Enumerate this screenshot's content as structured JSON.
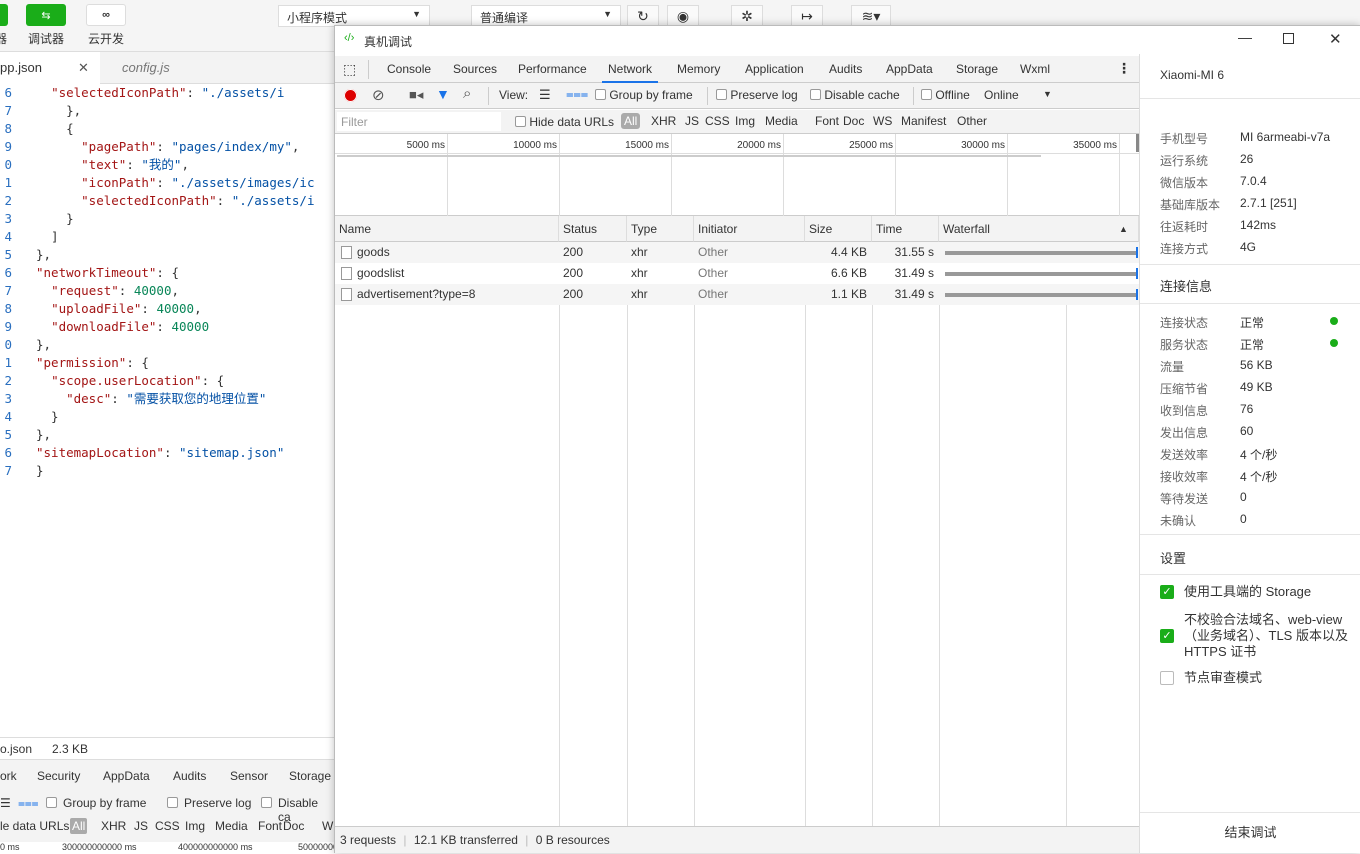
{
  "toolbar": {
    "debugger_label": "调试器",
    "cloud_label": "云开发",
    "mode_select": "小程序模式",
    "compile_select": "普通编译",
    "left_cut_label": "器"
  },
  "editor": {
    "tabs": [
      {
        "label": "pp.json"
      },
      {
        "label": "config.js"
      }
    ],
    "lines": [
      {
        "n": "6",
        "html": "  \"selectedIconPath\": \"./assets/i"
      },
      {
        "n": "7",
        "html": "    },"
      },
      {
        "n": "8",
        "html": "    {"
      },
      {
        "n": "9",
        "html": "      \"pagePath\": \"pages/index/my\","
      },
      {
        "n": "0",
        "html": "      \"text\": \"我的\","
      },
      {
        "n": "1",
        "html": "      \"iconPath\": \"./assets/images/ic"
      },
      {
        "n": "2",
        "html": "      \"selectedIconPath\": \"./assets/i"
      },
      {
        "n": "3",
        "html": "    }"
      },
      {
        "n": "4",
        "html": "  ]"
      },
      {
        "n": "5",
        "html": "},"
      },
      {
        "n": "6",
        "html": "\"networkTimeout\": {"
      },
      {
        "n": "7",
        "html": "  \"request\": 40000,"
      },
      {
        "n": "8",
        "html": "  \"uploadFile\": 40000,"
      },
      {
        "n": "9",
        "html": "  \"downloadFile\": 40000"
      },
      {
        "n": "0",
        "html": "},"
      },
      {
        "n": "1",
        "html": "\"permission\": {"
      },
      {
        "n": "2",
        "html": "  \"scope.userLocation\": {"
      },
      {
        "n": "3",
        "html": "    \"desc\": \"需要获取您的地理位置\""
      },
      {
        "n": "4",
        "html": "  }"
      },
      {
        "n": "5",
        "html": "},"
      },
      {
        "n": "6",
        "html": "\"sitemapLocation\": \"sitemap.json\""
      },
      {
        "n": "7",
        "html": "}"
      }
    ],
    "file_name": "o.json",
    "file_size": "2.3 KB",
    "bottom_tabs": [
      "ork",
      "Security",
      "AppData",
      "Audits",
      "Sensor",
      "Storage"
    ],
    "bottom_tools": [
      "Group by frame",
      "Preserve log",
      "Disable ca"
    ],
    "bottom_filter": [
      "le data URLs",
      "All",
      "XHR",
      "JS",
      "CSS",
      "Img",
      "Media",
      "Font",
      "Doc",
      "W"
    ],
    "bottom_ticks": [
      "0 ms",
      "300000000000 ms",
      "400000000000 ms",
      "50000000"
    ]
  },
  "devtools": {
    "title": "真机调试",
    "tabs": [
      "Console",
      "Sources",
      "Performance",
      "Network",
      "Memory",
      "Application",
      "Audits",
      "AppData",
      "Storage",
      "Wxml"
    ],
    "active_tab": "Network",
    "tools": {
      "view_label": "View:",
      "group_by_frame": "Group by frame",
      "preserve_log": "Preserve log",
      "disable_cache": "Disable cache",
      "offline": "Offline",
      "throttle": "Online"
    },
    "filter": {
      "placeholder": "Filter",
      "hide_data_urls": "Hide data URLs",
      "types": [
        "All",
        "XHR",
        "JS",
        "CSS",
        "Img",
        "Media",
        "Font",
        "Doc",
        "WS",
        "Manifest",
        "Other"
      ]
    },
    "timeline_ticks": [
      "5000 ms",
      "10000 ms",
      "15000 ms",
      "20000 ms",
      "25000 ms",
      "30000 ms",
      "35000 ms"
    ],
    "columns": [
      "Name",
      "Status",
      "Type",
      "Initiator",
      "Size",
      "Time",
      "Waterfall"
    ],
    "rows": [
      {
        "name": "goods",
        "status": "200",
        "type": "xhr",
        "initiator": "Other",
        "size": "4.4 KB",
        "time": "31.55 s"
      },
      {
        "name": "goodslist",
        "status": "200",
        "type": "xhr",
        "initiator": "Other",
        "size": "6.6 KB",
        "time": "31.49 s"
      },
      {
        "name": "advertisement?type=8",
        "status": "200",
        "type": "xhr",
        "initiator": "Other",
        "size": "1.1 KB",
        "time": "31.49 s"
      }
    ],
    "status_bar": {
      "requests": "3 requests",
      "transferred": "12.1 KB transferred",
      "resources": "0 B resources"
    }
  },
  "device": {
    "name": "Xiaomi-MI 6",
    "info": [
      {
        "k": "手机型号",
        "v": "MI 6armeabi-v7a"
      },
      {
        "k": "运行系统",
        "v": "26"
      },
      {
        "k": "微信版本",
        "v": "7.0.4"
      },
      {
        "k": "基础库版本",
        "v": "2.7.1 [251]"
      },
      {
        "k": "往返耗时",
        "v": "142ms"
      },
      {
        "k": "连接方式",
        "v": "4G"
      }
    ],
    "conn_title": "连接信息",
    "conn": [
      {
        "k": "连接状态",
        "v": "正常"
      },
      {
        "k": "服务状态",
        "v": "正常"
      },
      {
        "k": "流量",
        "v": "56 KB"
      },
      {
        "k": "压缩节省",
        "v": "49 KB"
      },
      {
        "k": "收到信息",
        "v": "76"
      },
      {
        "k": "发出信息",
        "v": "60"
      },
      {
        "k": "发送效率",
        "v": "4 个/秒"
      },
      {
        "k": "接收效率",
        "v": "4 个/秒"
      },
      {
        "k": "等待发送",
        "v": "0"
      },
      {
        "k": "未确认",
        "v": "0"
      }
    ],
    "settings_title": "设置",
    "settings": [
      {
        "label": "使用工具端的 Storage"
      },
      {
        "label": "不校验合法域名、web-view（业务域名）、TLS 版本以及 HTTPS 证书"
      },
      {
        "label": "节点审查模式"
      }
    ],
    "end_button": "结束调试"
  }
}
